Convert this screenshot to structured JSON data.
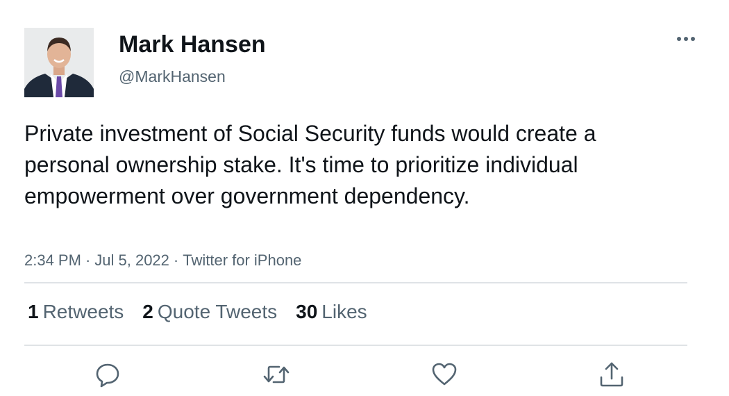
{
  "author": {
    "display_name": "Mark Hansen",
    "handle": "@MarkHansen"
  },
  "tweet": {
    "text": "Private investment of Social Security funds would create a personal ownership stake. It's time to prioritize individual empowerment over government dependency.",
    "time": "2:34 PM",
    "date": "Jul 5, 2022",
    "source": "Twitter for iPhone",
    "separator": "·"
  },
  "stats": {
    "retweets": {
      "count": "1",
      "label": "Retweets"
    },
    "quotes": {
      "count": "2",
      "label": "Quote Tweets"
    },
    "likes": {
      "count": "30",
      "label": "Likes"
    }
  },
  "icons": {
    "more": "more-icon",
    "reply": "reply-icon",
    "retweet": "retweet-icon",
    "like": "heart-icon",
    "share": "share-icon"
  },
  "colors": {
    "text": "#0f1419",
    "secondary": "#536471",
    "divider": "#dfe3e6",
    "icon": "#536471"
  }
}
